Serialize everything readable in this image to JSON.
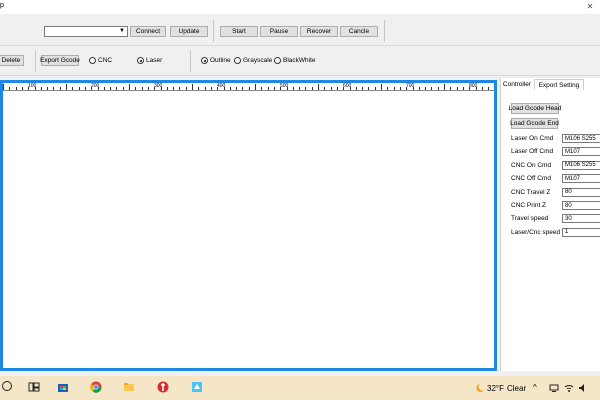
{
  "window": {
    "title_fragment": "p"
  },
  "toolbar1": {
    "port_select_value": "",
    "connect_label": "Connect",
    "update_label": "Update",
    "start_label": "Start",
    "pause_label": "Pause",
    "recover_label": "Recover",
    "cancle_label": "Cancle"
  },
  "toolbar2": {
    "delete_label": "Delete",
    "export_gcode_label": "Export Gcode",
    "mode_cnc_label": "CNC",
    "mode_laser_label": "Laser",
    "mode_selected": "Laser",
    "image_outline_label": "Outline",
    "image_grayscale_label": "Grayscale",
    "image_blackwhite_label": "BlackWhite",
    "image_selected": "Outline"
  },
  "ruler": {
    "labels": [
      "100",
      "200",
      "300",
      "400",
      "500",
      "600",
      "700",
      "800"
    ]
  },
  "panel": {
    "tabs": [
      {
        "label": "Controller"
      },
      {
        "label": "Export Setting"
      }
    ],
    "active_tab": "Export Setting",
    "load_head_label": "Load Gcode Head",
    "load_end_label": "Load Gcode End",
    "fields": [
      {
        "label": "Laser On Cmd",
        "value": "M106 S255"
      },
      {
        "label": "Laser Off Cmd",
        "value": "M107"
      },
      {
        "label": "CNC On Cmd",
        "value": "M106 S255"
      },
      {
        "label": "CNC Off Cmd",
        "value": "M107"
      },
      {
        "label": "CNC Travel Z",
        "value": "80"
      },
      {
        "label": "CNC Print Z",
        "value": "80"
      },
      {
        "label": "Travel speed",
        "value": "30"
      },
      {
        "label": "Laser/Cnc speed",
        "value": "1"
      }
    ]
  },
  "taskbar": {
    "weather_temp": "32°F",
    "weather_text": "Clear"
  },
  "colors": {
    "canvas_border": "#1e88e5",
    "taskbar_bg": "#f5e6c8"
  }
}
